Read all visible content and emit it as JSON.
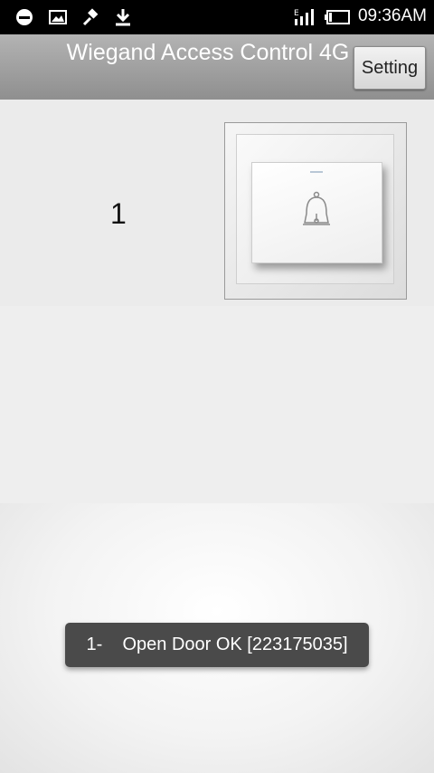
{
  "status_bar": {
    "time": "09:36AM",
    "icons": [
      "notification-icon",
      "image-icon",
      "tool-icon",
      "download-icon",
      "signal-icon",
      "battery-icon"
    ],
    "network_type": "E"
  },
  "header": {
    "title": "Wiegand Access Control 4G",
    "setting_label": "Setting"
  },
  "doors": [
    {
      "number": "1",
      "icon": "doorbell-switch-icon"
    }
  ],
  "toast": {
    "message": "1-    Open Door OK [223175035]"
  },
  "colors": {
    "status_bar": "#000000",
    "title_bar": "#a3a3a3",
    "row_bg": "#ebebeb",
    "toast_bg": "#4a4a4a"
  }
}
